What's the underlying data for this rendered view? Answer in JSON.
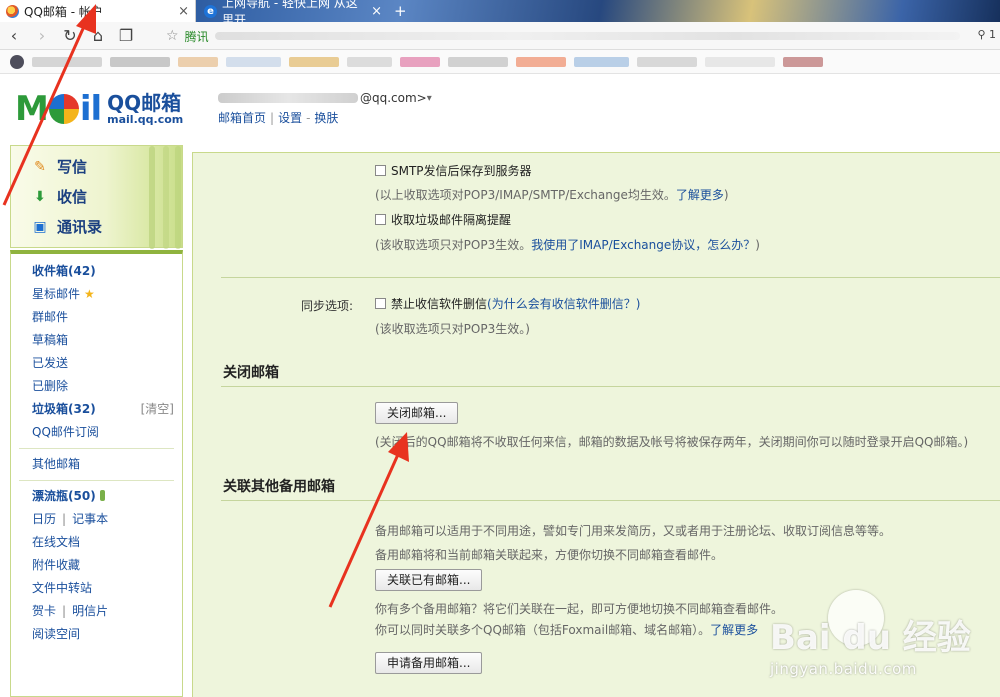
{
  "browser": {
    "tabs": [
      {
        "title": "QQ邮箱 - 帐户",
        "close": "×"
      },
      {
        "title": "上网导航 - 轻快上网 从这里开",
        "close": "×"
      }
    ],
    "new_tab": "+",
    "address_site": "腾讯",
    "zoom": "1",
    "nav": {
      "back": "‹",
      "forward": "›",
      "reload": "↻",
      "home": "⌂",
      "reader": "❐"
    }
  },
  "header": {
    "logo_cn": "QQ邮箱",
    "logo_en": "mail.qq.com",
    "account_suffix": "@qq.com>",
    "account_caret": "▾",
    "links": [
      "邮箱首页",
      "设置",
      "换肤"
    ]
  },
  "quick_actions": [
    {
      "label": "写信",
      "icon": "compose-icon"
    },
    {
      "label": "收信",
      "icon": "inbox-download-icon"
    },
    {
      "label": "通讯录",
      "icon": "contacts-icon"
    }
  ],
  "folders": {
    "inbox": {
      "label": "收件箱",
      "count": "(42)"
    },
    "starred": "星标邮件",
    "group": "群邮件",
    "drafts": "草稿箱",
    "sent": "已发送",
    "deleted": "已删除",
    "spam": {
      "label": "垃圾箱",
      "count": "(32)",
      "clear": "[清空]"
    },
    "subscriptions": "QQ邮件订阅",
    "other": "其他邮箱",
    "bottle": {
      "label": "漂流瓶",
      "count": "(50)"
    },
    "calendar": "日历",
    "notes": "记事本",
    "docs": "在线文档",
    "attachments": "附件收藏",
    "transfer": "文件中转站",
    "cards": "贺卡",
    "postcards": "明信片",
    "reading": "阅读空间"
  },
  "settings": {
    "smtp_save": "SMTP发信后保存到服务器",
    "hint_protocols": "(以上收取选项对POP3/IMAP/SMTP/Exchange均生效。",
    "hint_protocols_link": "了解更多",
    "hint_protocols_end": ")",
    "spam_isolation": "收取垃圾邮件隔离提醒",
    "hint_pop3_only": "(该收取选项只对POP3生效。",
    "hint_imap_link": "我使用了IMAP/Exchange协议，怎么办？",
    "hint_pop3_end": ")",
    "sync_label": "同步选项:",
    "sync_option": "禁止收信软件删信",
    "sync_why": "(为什么会有收信软件删信？)",
    "sync_hint": "(该收取选项只对POP3生效。)"
  },
  "close_mailbox": {
    "title": "关闭邮箱",
    "button": "关闭邮箱...",
    "hint": "(关闭后的QQ邮箱将不收取任何来信，邮箱的数据及帐号将被保存两年，关闭期间你可以随时登录开启QQ邮箱。)"
  },
  "linked_mailboxes": {
    "title": "关联其他备用邮箱",
    "desc1": "备用邮箱可以适用于不同用途，譬如专门用来发简历，又或者用于注册论坛、收取订阅信息等等。",
    "desc2": "备用邮箱将和当前邮箱关联起来，方便你切换不同邮箱查看邮件。",
    "link_button": "关联已有邮箱...",
    "hint1": "你有多个备用邮箱？将它们关联在一起，即可方便地切换不同邮箱查看邮件。",
    "hint2": "你可以同时关联多个QQ邮箱（包括Foxmail邮箱、域名邮箱）。",
    "hint2_link": "了解更多",
    "apply_button": "申请备用邮箱..."
  },
  "watermark": {
    "logo": "Bai du 经验",
    "url": "jingyan.baidu.com"
  },
  "colors": {
    "accent_blue": "#1a4f9c",
    "panel_green": "#eef5dc",
    "arrow_red": "#e8321f"
  }
}
